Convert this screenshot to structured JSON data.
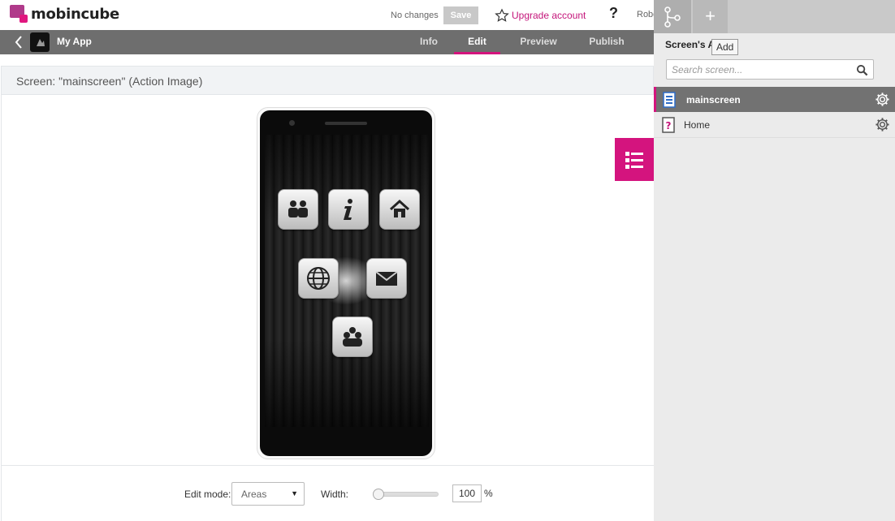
{
  "brand": {
    "name": "mobincube"
  },
  "header": {
    "status": "No changes",
    "save_label": "Save",
    "upgrade_label": "Upgrade account",
    "help_label": "?",
    "user": "Robe"
  },
  "nav": {
    "app_name": "My App",
    "tabs": [
      {
        "label": "Info"
      },
      {
        "label": "Edit",
        "active": true
      },
      {
        "label": "Preview"
      },
      {
        "label": "Publish"
      }
    ]
  },
  "screen": {
    "title": "Screen: \"mainscreen\" (Action Image)",
    "buttons": [
      {
        "icon": "people-icon"
      },
      {
        "icon": "info-icon"
      },
      {
        "icon": "home-icon"
      },
      {
        "icon": "globe-icon"
      },
      {
        "icon": "mail-icon"
      },
      {
        "icon": "group-icon"
      }
    ]
  },
  "controls": {
    "edit_mode_label": "Edit mode:",
    "edit_mode_value": "Areas",
    "width_label": "Width:",
    "width_value": "100",
    "width_unit": "%",
    "width_slider_fraction": 0
  },
  "panel": {
    "title": "Screen's Ap",
    "add_tooltip": "Add",
    "search_placeholder": "Search screen...",
    "screens": [
      {
        "name": "mainscreen",
        "active": true
      },
      {
        "name": "Home",
        "active": false
      }
    ]
  },
  "colors": {
    "accent": "#d4147e",
    "nav_bg": "#6e6e6e",
    "panel_bg": "#ebebeb"
  }
}
